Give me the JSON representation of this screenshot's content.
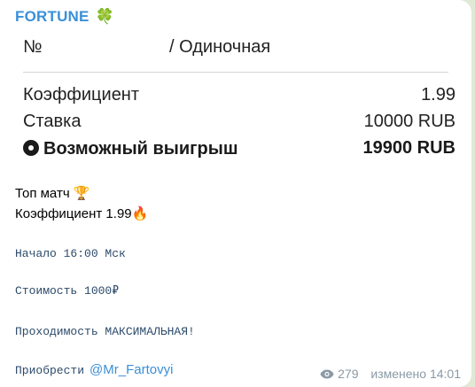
{
  "message": {
    "sender": "FORTUNE",
    "sender_emoji": "🍀",
    "ticket": {
      "number_label": "№",
      "bet_type": "/ Одиночная",
      "rows": [
        {
          "label": "Коэффициент",
          "value": "1.99"
        },
        {
          "label": "Ставка",
          "value": "10000 RUB"
        },
        {
          "label": "Возможный выигрыш",
          "value": "19900 RUB"
        }
      ]
    },
    "lines": {
      "top_match": "Топ матч 🏆",
      "coef": "Коэффициент 1.99🔥",
      "start": "Начало 16:00 Мск",
      "price": "Стоимость 1000₽",
      "pass": "Проходимость МАКСИМАЛЬНАЯ!",
      "buy": "Приобрести",
      "buy_link": "@Mr_Fartovyi"
    },
    "meta": {
      "views": "279",
      "edited": "изменено 14:01"
    }
  },
  "colors": {
    "background": "#dfe9d5",
    "bubble": "#ffffff",
    "accent": "#3a8fd9"
  }
}
